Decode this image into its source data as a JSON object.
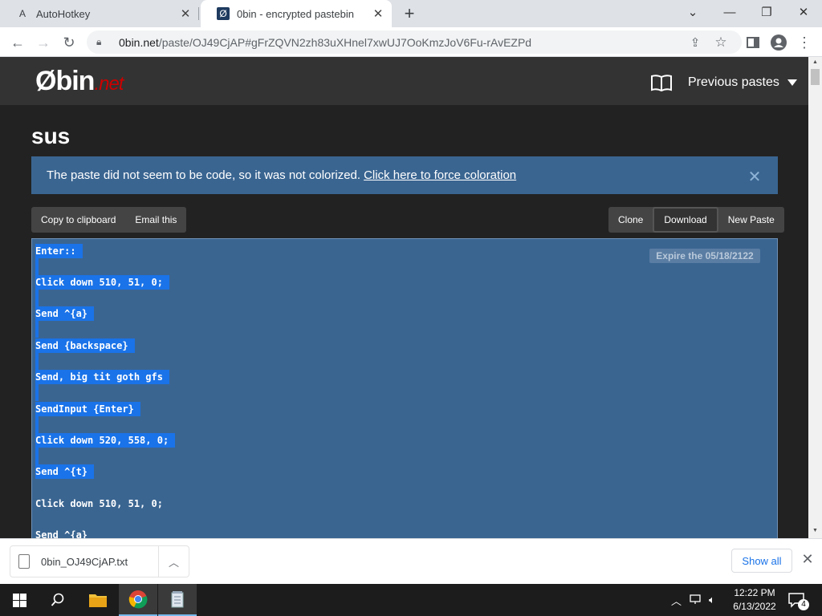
{
  "browser": {
    "tabs": [
      {
        "label": "AutoHotkey",
        "favicon": "A"
      },
      {
        "label": "0bin - encrypted pastebin",
        "favicon": "Ø"
      }
    ],
    "url_host": "0bin.net",
    "url_rest": "/paste/OJ49CjAP#gFrZQVN2zh83uXHnel7xwUJ7OoKmzJoV6Fu-rAvEZPd"
  },
  "site": {
    "logo_main": "Øbin",
    "logo_suffix": ".net",
    "previous_pastes": "Previous pastes"
  },
  "paste": {
    "title": "sus",
    "alert_text": "The paste did not seem to be code, so it was not colorized.",
    "alert_link": "Click here to force coloration",
    "buttons_left": [
      "Copy to clipboard",
      "Email this"
    ],
    "buttons_right": [
      "Clone",
      "Download",
      "New Paste"
    ],
    "expire": "Expire the 05/18/2122",
    "lines": [
      "Enter::",
      "Click down 510, 51, 0;",
      "Send ^{a}",
      "Send {backspace}",
      "Send, big tit goth gfs",
      "SendInput {Enter}",
      "Click down 520, 558, 0;",
      "Send ^{t}",
      "Click down 510, 51, 0;",
      "Send ^{a}"
    ]
  },
  "download_shelf": {
    "filename": "0bin_OJ49CjAP.txt",
    "show_all": "Show all"
  },
  "taskbar": {
    "time": "12:22 PM",
    "date": "6/13/2022",
    "notification_count": "4"
  },
  "colors": {
    "accent": "#1a73e8",
    "alert_bg": "#3a6591",
    "page_bg": "#222222",
    "header_bg": "#333333",
    "logo_accent": "#cc0000"
  }
}
